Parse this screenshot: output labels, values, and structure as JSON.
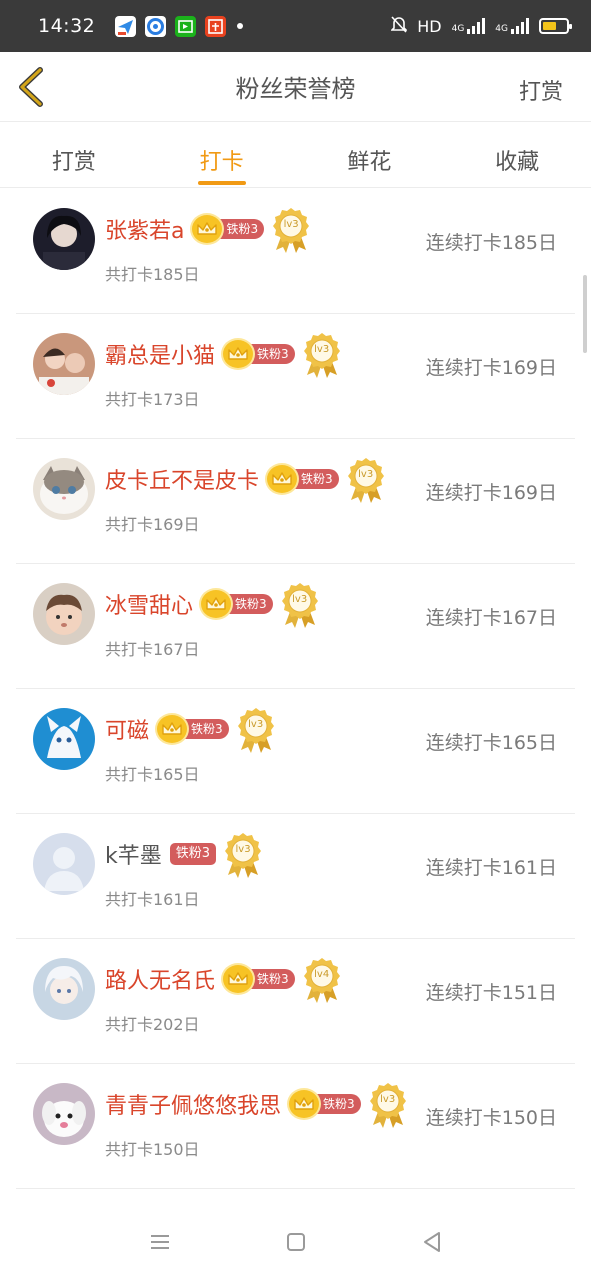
{
  "status_bar": {
    "time": "14:32",
    "network": "HD",
    "signal1": "4G",
    "signal2": "4G",
    "app_icons": [
      "send-icon",
      "browser-icon",
      "iqiyi-icon",
      "taobao-icon"
    ],
    "colors": {
      "bg": "#3a3a3a",
      "battery": "#f2c31a"
    }
  },
  "header": {
    "back_icon": "chevron-left-icon",
    "title": "粉丝荣誉榜",
    "action": "打赏",
    "back_color": "#d3a51a"
  },
  "tabs": [
    {
      "label": "打赏",
      "active": false
    },
    {
      "label": "打卡",
      "active": true
    },
    {
      "label": "鲜花",
      "active": false
    },
    {
      "label": "收藏",
      "active": false
    }
  ],
  "accent_color": "#f19a14",
  "fans": [
    {
      "name": "张紫若a",
      "has_crown": true,
      "fan_badge": "铁粉3",
      "level": "lv3",
      "total": "共打卡185日",
      "streak": "连续打卡185日",
      "avatar": "dark-portrait"
    },
    {
      "name": "霸总是小猫",
      "has_crown": true,
      "fan_badge": "铁粉3",
      "level": "lv3",
      "total": "共打卡173日",
      "streak": "连续打卡169日",
      "avatar": "couple-photo"
    },
    {
      "name": "皮卡丘不是皮卡",
      "has_crown": true,
      "fan_badge": "铁粉3",
      "level": "lv3",
      "total": "共打卡169日",
      "streak": "连续打卡169日",
      "avatar": "cat"
    },
    {
      "name": "冰雪甜心",
      "has_crown": true,
      "fan_badge": "铁粉3",
      "level": "lv3",
      "total": "共打卡167日",
      "streak": "连续打卡167日",
      "avatar": "baby"
    },
    {
      "name": "可磁",
      "has_crown": true,
      "fan_badge": "铁粉3",
      "level": "lv3",
      "total": "共打卡165日",
      "streak": "连续打卡165日",
      "avatar": "anime-fox"
    },
    {
      "name": "k芊墨",
      "has_crown": false,
      "fan_badge": "铁粉3",
      "level": "lv3",
      "total": "共打卡161日",
      "streak": "连续打卡161日",
      "avatar": "default-user"
    },
    {
      "name": "路人无名氏",
      "has_crown": true,
      "fan_badge": "铁粉3",
      "level": "lv4",
      "total": "共打卡202日",
      "streak": "连续打卡151日",
      "avatar": "anime-white-hair"
    },
    {
      "name": "青青子佩悠悠我思",
      "has_crown": true,
      "fan_badge": "铁粉3",
      "level": "lv3",
      "total": "共打卡150日",
      "streak": "连续打卡150日",
      "avatar": "white-dog"
    }
  ],
  "nav_bar": {
    "buttons": [
      "menu-icon",
      "home-icon",
      "back-triangle-icon"
    ]
  }
}
